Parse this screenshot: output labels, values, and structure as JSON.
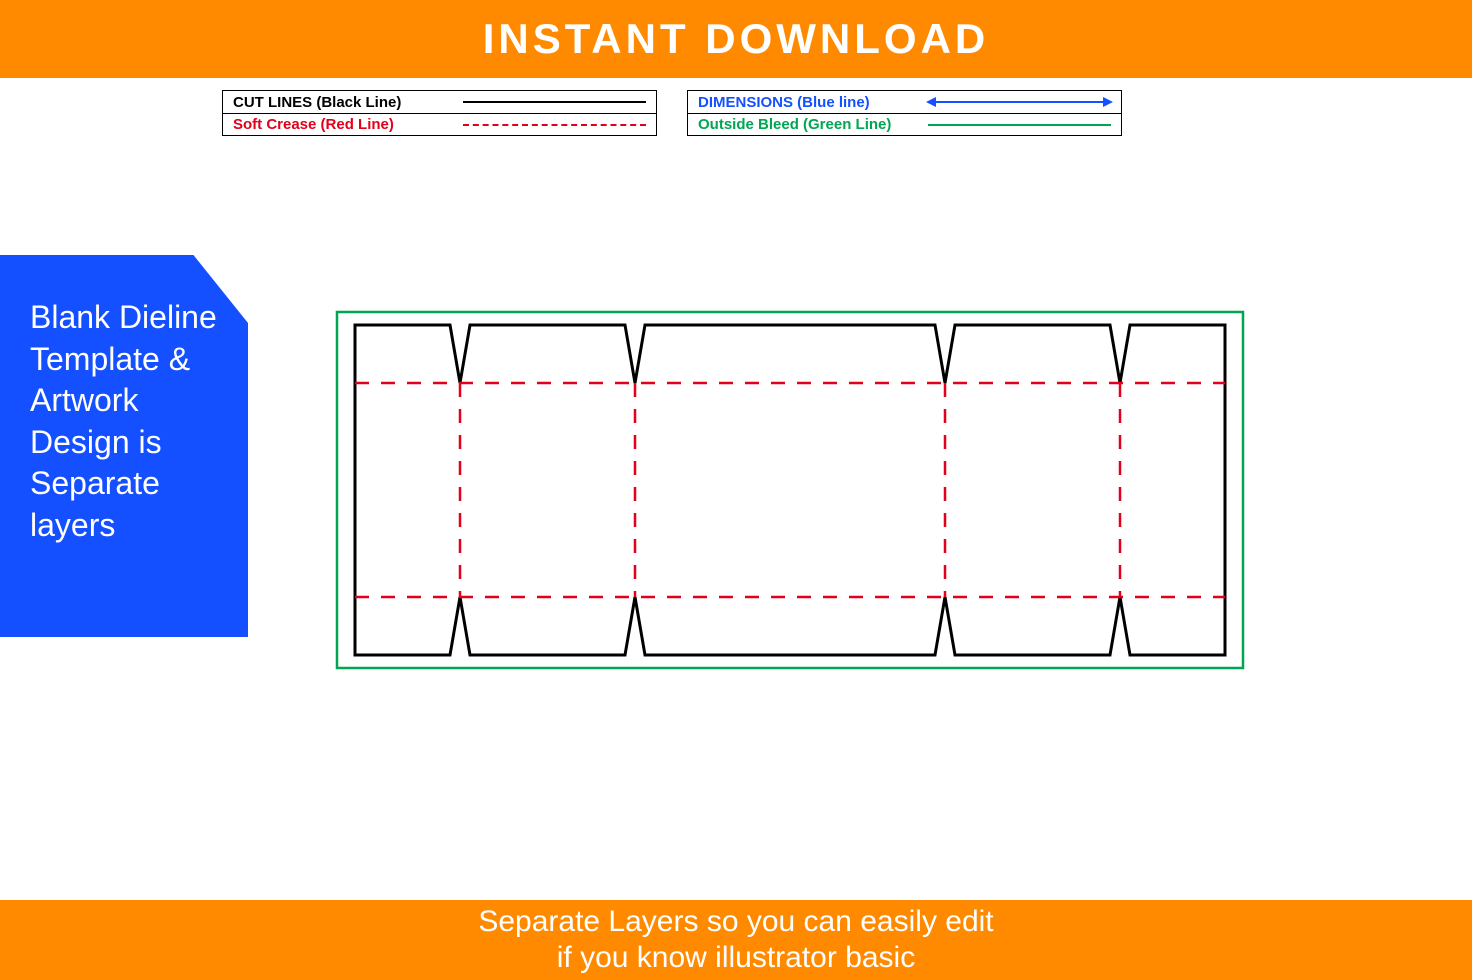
{
  "banner_top": "INSTANT DOWNLOAD",
  "banner_bottom_line1": "Separate Layers so you can easily edit",
  "banner_bottom_line2": "if you know illustrator basic",
  "legend": {
    "cut": "CUT LINES (Black Line)",
    "crease": "Soft Crease (Red Line)",
    "dimensions": "DIMENSIONS (Blue line)",
    "bleed": "Outside Bleed (Green Line)"
  },
  "side_panel": "Blank Dieline Template & Artwork Design is Separate layers",
  "colors": {
    "orange": "#ff8a00",
    "blue_panel": "#1450ff",
    "cut": "#000000",
    "crease": "#e2001a",
    "dimension": "#1450ff",
    "bleed": "#00a651"
  }
}
